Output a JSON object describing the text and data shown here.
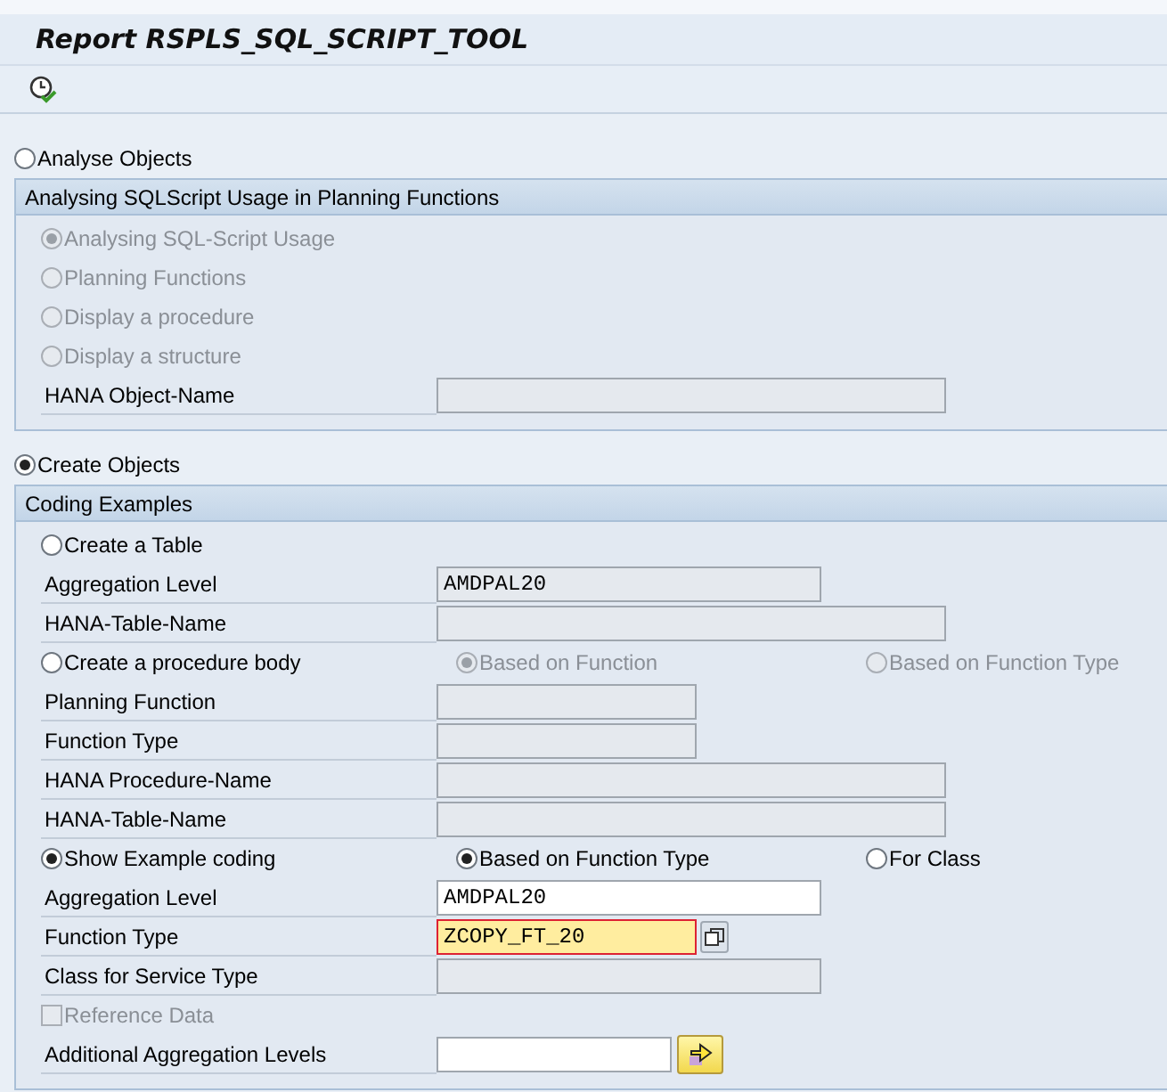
{
  "window": {
    "title": "Report RSPLS_SQL_SCRIPT_TOOL"
  },
  "toolbar": {
    "execute": {
      "disabled": false
    }
  },
  "sections": [
    {
      "option": {
        "label": "Analyse Objects",
        "selected": false
      },
      "group": {
        "title": "Analysing SQLScript Usage in Planning Functions",
        "rows": [
          {
            "kind": "radios",
            "options": [
              {
                "label": "Analysing SQL-Script Usage",
                "selected": true,
                "disabled": true
              }
            ]
          },
          {
            "kind": "radios",
            "options": [
              {
                "label": "Planning Functions",
                "selected": false,
                "disabled": true
              }
            ]
          },
          {
            "kind": "radios",
            "options": [
              {
                "label": "Display a procedure",
                "selected": false,
                "disabled": true
              }
            ]
          },
          {
            "kind": "radios",
            "options": [
              {
                "label": "Display a structure",
                "selected": false,
                "disabled": true
              }
            ]
          },
          {
            "kind": "longfield",
            "label": "HANA Object-Name",
            "editable": false
          }
        ]
      }
    },
    {
      "option": {
        "label": "Create Objects",
        "selected": true
      },
      "group": {
        "title": "Coding Examples",
        "rows": [
          {
            "kind": "radios",
            "options": [
              {
                "label": "Create a Table",
                "selected": false,
                "disabled": false
              }
            ]
          },
          {
            "kind": "mediumfield",
            "label": "Aggregation Level",
            "value": "AMDPAL20",
            "editable": false
          },
          {
            "kind": "longfield",
            "label": "HANA-Table-Name",
            "editable": false
          },
          {
            "kind": "radios",
            "options": [
              {
                "label": "Create a procedure body",
                "selected": false,
                "disabled": false
              },
              {
                "label": "Based on Function",
                "selected": true,
                "disabled": true
              },
              {
                "label": "Based on Function Type",
                "selected": false,
                "disabled": true
              }
            ]
          },
          {
            "kind": "shortfield",
            "label": "Planning Function",
            "editable": false
          },
          {
            "kind": "shortfield",
            "label": "Function Type",
            "editable": false
          },
          {
            "kind": "longfield",
            "label": "HANA Procedure-Name",
            "editable": false
          },
          {
            "kind": "longfield",
            "label": "HANA-Table-Name",
            "editable": false
          },
          {
            "kind": "radios",
            "options": [
              {
                "label": "Show Example coding",
                "selected": true,
                "disabled": false
              },
              {
                "label": "Based on Function Type",
                "selected": true,
                "disabled": false
              },
              {
                "label": "For Class",
                "selected": false,
                "disabled": false
              }
            ]
          },
          {
            "kind": "mediumfield",
            "label": "Aggregation Level",
            "value": "AMDPAL20",
            "editable": true
          },
          {
            "kind": "shortfield",
            "label": "Function Type",
            "value": "ZCOPY_FT_20",
            "editable": true,
            "focused": true,
            "value_help": true
          },
          {
            "kind": "mediumfield",
            "label": "Class for Service Type",
            "editable": false
          },
          {
            "kind": "checkbox",
            "label": "Reference Data",
            "checked": false,
            "disabled": true
          },
          {
            "kind": "tinyfield",
            "label": "Additional Aggregation Levels",
            "editable": true,
            "multiple_selection": true
          }
        ]
      }
    }
  ]
}
